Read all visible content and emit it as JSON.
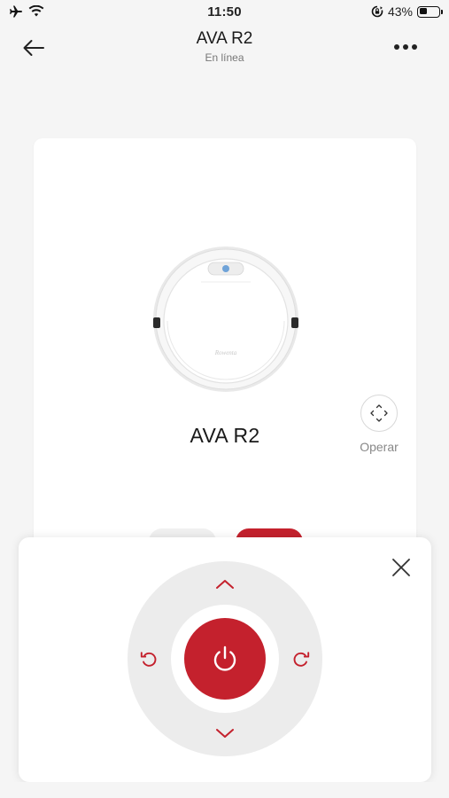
{
  "status_bar": {
    "time": "11:50",
    "battery_percent_label": "43%",
    "battery_level": 0.43,
    "icons": [
      "airplane-icon",
      "wifi-icon",
      "orientation-lock-icon",
      "battery-icon"
    ]
  },
  "header": {
    "title": "AVA R2",
    "subtitle": "En línea",
    "icons": [
      "back-arrow-icon",
      "more-options-icon"
    ]
  },
  "device": {
    "name": "AVA R2",
    "image": "robot-vacuum",
    "operate_label": "Operar",
    "operate_icon": "move-arrows-icon"
  },
  "remote_panel": {
    "icons": {
      "close": "close-icon",
      "up": "chevron-up-icon",
      "down": "chevron-down-icon",
      "rotate_left": "rotate-left-icon",
      "rotate_right": "rotate-right-icon",
      "power": "power-icon"
    }
  },
  "colors": {
    "accent": "#c4212d",
    "background": "#f5f5f5",
    "dpad": "#ececec",
    "muted_text": "#888888"
  }
}
